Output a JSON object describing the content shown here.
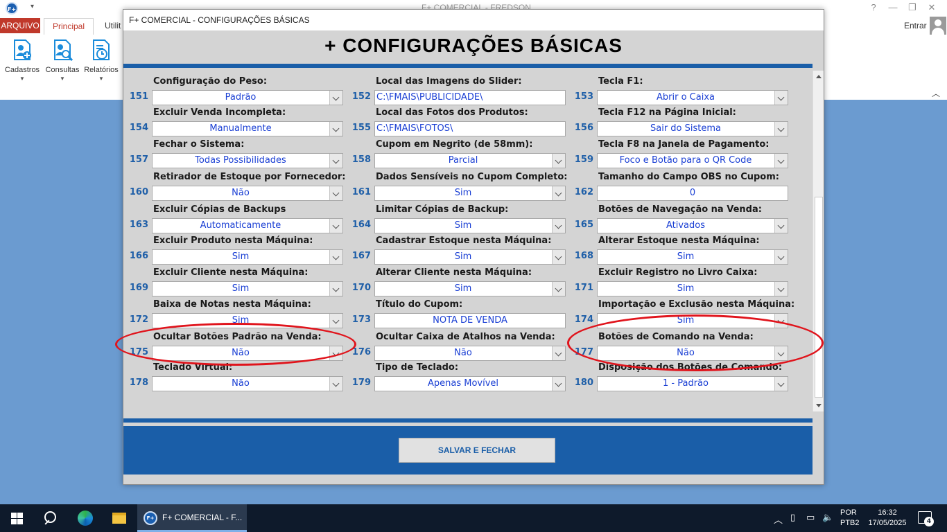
{
  "background_app": {
    "quick_access": "▾",
    "title": "F+ COMERCIAL - FREDSON",
    "tab_arquivo": "ARQUIVO",
    "tab_principal": "Principal",
    "tab_utilities_partial": "Utilit",
    "entrar": "Entrar",
    "window_controls": [
      "?",
      "—",
      "❐",
      "✕"
    ],
    "ribbon_buttons": [
      {
        "label": "Cadastros",
        "icon": "person-add-icon"
      },
      {
        "label": "Consultas",
        "icon": "person-search-icon"
      },
      {
        "label": "Relatórios",
        "icon": "report-clock-icon"
      }
    ]
  },
  "dialog": {
    "title": "F+ COMERCIAL - CONFIGURAÇÕES BÁSICAS",
    "heading": "+ CONFIGURAÇÕES BÁSICAS",
    "save_button": "SALVAR E FECHAR",
    "fields": [
      {
        "num": "151",
        "label": "Configuração do Peso:",
        "type": "combo",
        "value": "Padrão"
      },
      {
        "num": "152",
        "label": "Local das Imagens do Slider:",
        "type": "text",
        "value": "C:\\FMAIS\\PUBLICIDADE\\"
      },
      {
        "num": "153",
        "label": "Tecla F1:",
        "type": "combo",
        "value": "Abrir o Caixa"
      },
      {
        "num": "154",
        "label": "Excluir Venda Incompleta:",
        "type": "combo",
        "value": "Manualmente"
      },
      {
        "num": "155",
        "label": "Local das Fotos dos Produtos:",
        "type": "text",
        "value": "C:\\FMAIS\\FOTOS\\"
      },
      {
        "num": "156",
        "label": "Tecla F12 na Página Inicial:",
        "type": "combo",
        "value": "Sair do Sistema"
      },
      {
        "num": "157",
        "label": "Fechar o Sistema:",
        "type": "combo",
        "value": "Todas Possibilidades"
      },
      {
        "num": "158",
        "label": "Cupom em Negrito (de 58mm):",
        "type": "combo",
        "value": "Parcial"
      },
      {
        "num": "159",
        "label": "Tecla F8 na Janela de Pagamento:",
        "type": "combo",
        "value": "Foco e Botão para o QR Code"
      },
      {
        "num": "160",
        "label": "Retirador de Estoque por Fornecedor:",
        "type": "combo",
        "value": "Não"
      },
      {
        "num": "161",
        "label": "Dados Sensíveis no Cupom Completo:",
        "type": "combo",
        "value": "Sim"
      },
      {
        "num": "162",
        "label": "Tamanho do Campo OBS no Cupom:",
        "type": "textc",
        "value": "0"
      },
      {
        "num": "163",
        "label": "Excluir Cópias de Backups",
        "type": "combo",
        "value": "Automaticamente"
      },
      {
        "num": "164",
        "label": "Limitar Cópias de Backup:",
        "type": "combo",
        "value": "Sim"
      },
      {
        "num": "165",
        "label": "Botões de Navegação na Venda:",
        "type": "combo",
        "value": "Ativados"
      },
      {
        "num": "166",
        "label": "Excluir Produto nesta Máquina:",
        "type": "combo",
        "value": "Sim"
      },
      {
        "num": "167",
        "label": "Cadastrar Estoque nesta Máquina:",
        "type": "combo",
        "value": "Sim"
      },
      {
        "num": "168",
        "label": "Alterar Estoque nesta Máquina:",
        "type": "combo",
        "value": "Sim"
      },
      {
        "num": "169",
        "label": "Excluir Cliente nesta Máquina:",
        "type": "combo",
        "value": "Sim"
      },
      {
        "num": "170",
        "label": "Alterar Cliente nesta Máquina:",
        "type": "combo",
        "value": "Sim"
      },
      {
        "num": "171",
        "label": "Excluir Registro no Livro Caixa:",
        "type": "combo",
        "value": "Sim"
      },
      {
        "num": "172",
        "label": "Baixa de Notas nesta Máquina:",
        "type": "combo",
        "value": "Sim"
      },
      {
        "num": "173",
        "label": "Título do Cupom:",
        "type": "textc",
        "value": "NOTA DE VENDA"
      },
      {
        "num": "174",
        "label": "Importação e Exclusão nesta Máquina:",
        "type": "combo",
        "value": "Sim"
      },
      {
        "num": "175",
        "label": "Ocultar Botões Padrão na Venda:",
        "type": "combo",
        "value": "Não"
      },
      {
        "num": "176",
        "label": "Ocultar Caixa de Atalhos na Venda:",
        "type": "combo",
        "value": "Não"
      },
      {
        "num": "177",
        "label": "Botões de Comando na Venda:",
        "type": "combo",
        "value": "Não"
      },
      {
        "num": "178",
        "label": "Teclado Virtual:",
        "type": "combo",
        "value": "Não"
      },
      {
        "num": "179",
        "label": "Tipo de Teclado:",
        "type": "combo",
        "value": "Apenas Movível"
      },
      {
        "num": "180",
        "label": "Disposição dos Botões de Comando:",
        "type": "combo",
        "value": "1 - Padrão"
      }
    ]
  },
  "taskbar": {
    "app_label": "F+ COMERCIAL - F...",
    "language": [
      "POR",
      "PTB2"
    ],
    "time": "16:32",
    "date": "17/05/2025",
    "notifications": "4"
  },
  "colors": {
    "accent_blue": "#1a5ea8",
    "field_number": "#1f5fa8",
    "field_value": "#1a3fd4",
    "highlight_red": "#e0141c",
    "arquivo_tab": "#c0392b"
  }
}
